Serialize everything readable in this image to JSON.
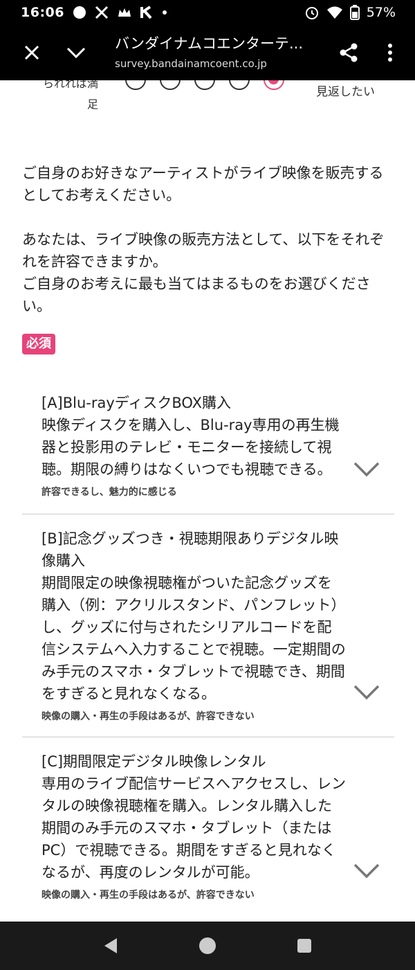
{
  "status": {
    "time": "16:06",
    "battery": "57%"
  },
  "browser": {
    "title": "バンダイナムコエンターテ...",
    "url": "survey.bandainamcoent.co.jp"
  },
  "scale": {
    "left_label_line1": "られれば満",
    "left_label_line2": "足",
    "right_label": "見返したい"
  },
  "question": {
    "para1": "ご自身のお好きなアーティストがライブ映像を販売するとしてお考えください。",
    "para2_line1": "あなたは、ライブ映像の販売方法として、以下をそれぞれを許容できますか。",
    "para2_line2": "ご自身のお考えに最も当てはまるものをお選びください。"
  },
  "required_label": "必須",
  "items": [
    {
      "title": "[A]Blu-rayディスクBOX購入",
      "desc": "映像ディスクを購入し、Blu-ray専用の再生機器と投影用のテレビ・モニターを接続して視聴。期限の縛りはなくいつでも視聴できる。",
      "answer": "許容できるし、魅力的に感じる"
    },
    {
      "title": "[B]記念グッズつき・視聴期限ありデジタル映像購入",
      "desc": "期間限定の映像視聴権がついた記念グッズを購入（例：アクリルスタンド、パンフレット）し、グッズに付与されたシリアルコードを配信システムへ入力することで視聴。一定期間のみ手元のスマホ・タブレットで視聴でき、期間をすぎると見れなくなる。",
      "answer": "映像の購入・再生の手段はあるが、許容できない"
    },
    {
      "title": "[C]期間限定デジタル映像レンタル",
      "desc": "専用のライブ配信サービスへアクセスし、レンタルの映像視聴権を購入。レンタル購入した期間のみ手元のスマホ・タブレット（またはPC）で視聴できる。期間をすぎると見れなくなるが、再度のレンタルが可能。",
      "answer": "映像の購入・再生の手段はあるが、許容できない"
    }
  ],
  "colors": {
    "accent": "#e6447a",
    "selected_radio": "#e74c7c"
  }
}
